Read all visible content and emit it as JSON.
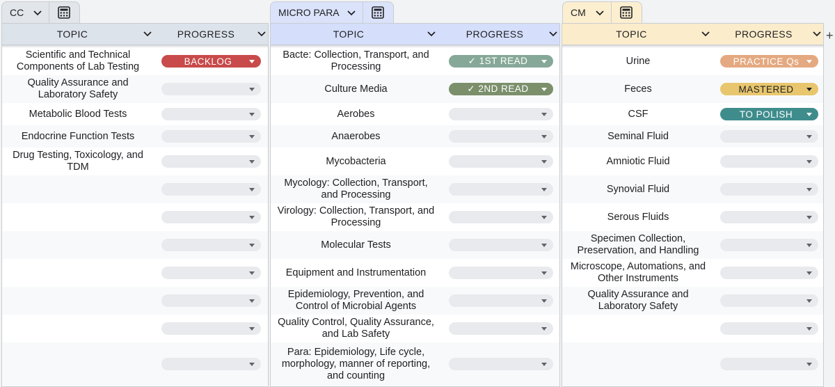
{
  "colors": {
    "cc_header": "#dde3ea",
    "micro_header": "#d5defa",
    "cm_header": "#fbeccb",
    "cc_tab": "#e2e6ea",
    "micro_tab": "#dbe3fb",
    "cm_tab": "#fcefd0"
  },
  "sheets": [
    {
      "tab": "CC",
      "tab_icon": "calculator-icon",
      "columns": {
        "topic": "TOPIC",
        "progress": "PROGRESS"
      },
      "rows": [
        {
          "topic": "Scientific and Technical Components of Lab Testing",
          "progress": "BACKLOG",
          "status": "backlog"
        },
        {
          "topic": "Quality Assurance and Laboratory Safety",
          "progress": "",
          "status": "empty"
        },
        {
          "topic": "Metabolic Blood Tests",
          "progress": "",
          "status": "empty"
        },
        {
          "topic": "Endocrine Function Tests",
          "progress": "",
          "status": "empty"
        },
        {
          "topic": "Drug Testing, Toxicology, and TDM",
          "progress": "",
          "status": "empty"
        },
        {
          "topic": "",
          "progress": "",
          "status": "empty"
        },
        {
          "topic": "",
          "progress": "",
          "status": "empty"
        },
        {
          "topic": "",
          "progress": "",
          "status": "empty"
        },
        {
          "topic": "",
          "progress": "",
          "status": "empty"
        },
        {
          "topic": "",
          "progress": "",
          "status": "empty"
        },
        {
          "topic": "",
          "progress": "",
          "status": "empty"
        },
        {
          "topic": "",
          "progress": "",
          "status": "empty"
        }
      ]
    },
    {
      "tab": "MICRO PARA",
      "tab_icon": "calculator-icon",
      "columns": {
        "topic": "TOPIC",
        "progress": "PROGRESS"
      },
      "rows": [
        {
          "topic": "Bacte: Collection, Transport, and Processing",
          "progress": "✓ 1ST READ",
          "status": "first_read"
        },
        {
          "topic": "Culture Media",
          "progress": "✓ 2ND READ",
          "status": "second_read"
        },
        {
          "topic": "Aerobes",
          "progress": "",
          "status": "empty"
        },
        {
          "topic": "Anaerobes",
          "progress": "",
          "status": "empty"
        },
        {
          "topic": "Mycobacteria",
          "progress": "",
          "status": "empty"
        },
        {
          "topic": "Mycology: Collection, Transport, and Processing",
          "progress": "",
          "status": "empty"
        },
        {
          "topic": "Virology: Collection, Transport, and Processing",
          "progress": "",
          "status": "empty"
        },
        {
          "topic": "Molecular Tests",
          "progress": "",
          "status": "empty"
        },
        {
          "topic": "Equipment and Instrumentation",
          "progress": "",
          "status": "empty"
        },
        {
          "topic": "Epidemiology, Prevention, and Control of Microbial Agents",
          "progress": "",
          "status": "empty"
        },
        {
          "topic": "Quality Control, Quality Assurance, and Lab Safety",
          "progress": "",
          "status": "empty"
        },
        {
          "topic": "Para: Epidemiology, Life cycle, morphology, manner of reporting, and counting",
          "progress": "",
          "status": "empty"
        }
      ]
    },
    {
      "tab": "CM",
      "tab_icon": "calculator-icon",
      "columns": {
        "topic": "TOPIC",
        "progress": "PROGRESS"
      },
      "rows": [
        {
          "topic": "Urine",
          "progress": "PRACTICE Qs",
          "status": "practice"
        },
        {
          "topic": "Feces",
          "progress": "MASTERED",
          "status": "mastered"
        },
        {
          "topic": "CSF",
          "progress": "TO POLISH",
          "status": "polish"
        },
        {
          "topic": "Seminal Fluid",
          "progress": "",
          "status": "empty"
        },
        {
          "topic": "Amniotic Fluid",
          "progress": "",
          "status": "empty"
        },
        {
          "topic": "Synovial Fluid",
          "progress": "",
          "status": "empty"
        },
        {
          "topic": "Serous Fluids",
          "progress": "",
          "status": "empty"
        },
        {
          "topic": "Specimen Collection, Preservation, and Handling",
          "progress": "",
          "status": "empty"
        },
        {
          "topic": "Microscope, Automations, and Other Instruments",
          "progress": "",
          "status": "empty"
        },
        {
          "topic": "Quality Assurance and Laboratory Safety",
          "progress": "",
          "status": "empty"
        },
        {
          "topic": "",
          "progress": "",
          "status": "empty"
        },
        {
          "topic": "",
          "progress": "",
          "status": "empty"
        }
      ]
    }
  ],
  "status_styles": {
    "backlog": {
      "bg": "#c84a4a",
      "fg": "#ffffff"
    },
    "first_read": {
      "bg": "#86a898",
      "fg": "#ffffff"
    },
    "second_read": {
      "bg": "#7b8f6b",
      "fg": "#ffffff"
    },
    "practice": {
      "bg": "#e4a980",
      "fg": "#ffffff"
    },
    "mastered": {
      "bg": "#e8c66e",
      "fg": "#202124"
    },
    "polish": {
      "bg": "#3f8c8c",
      "fg": "#ffffff"
    },
    "empty": {
      "bg": "#e8eaed",
      "fg": "#202124"
    }
  },
  "add_icon": "plus-icon"
}
